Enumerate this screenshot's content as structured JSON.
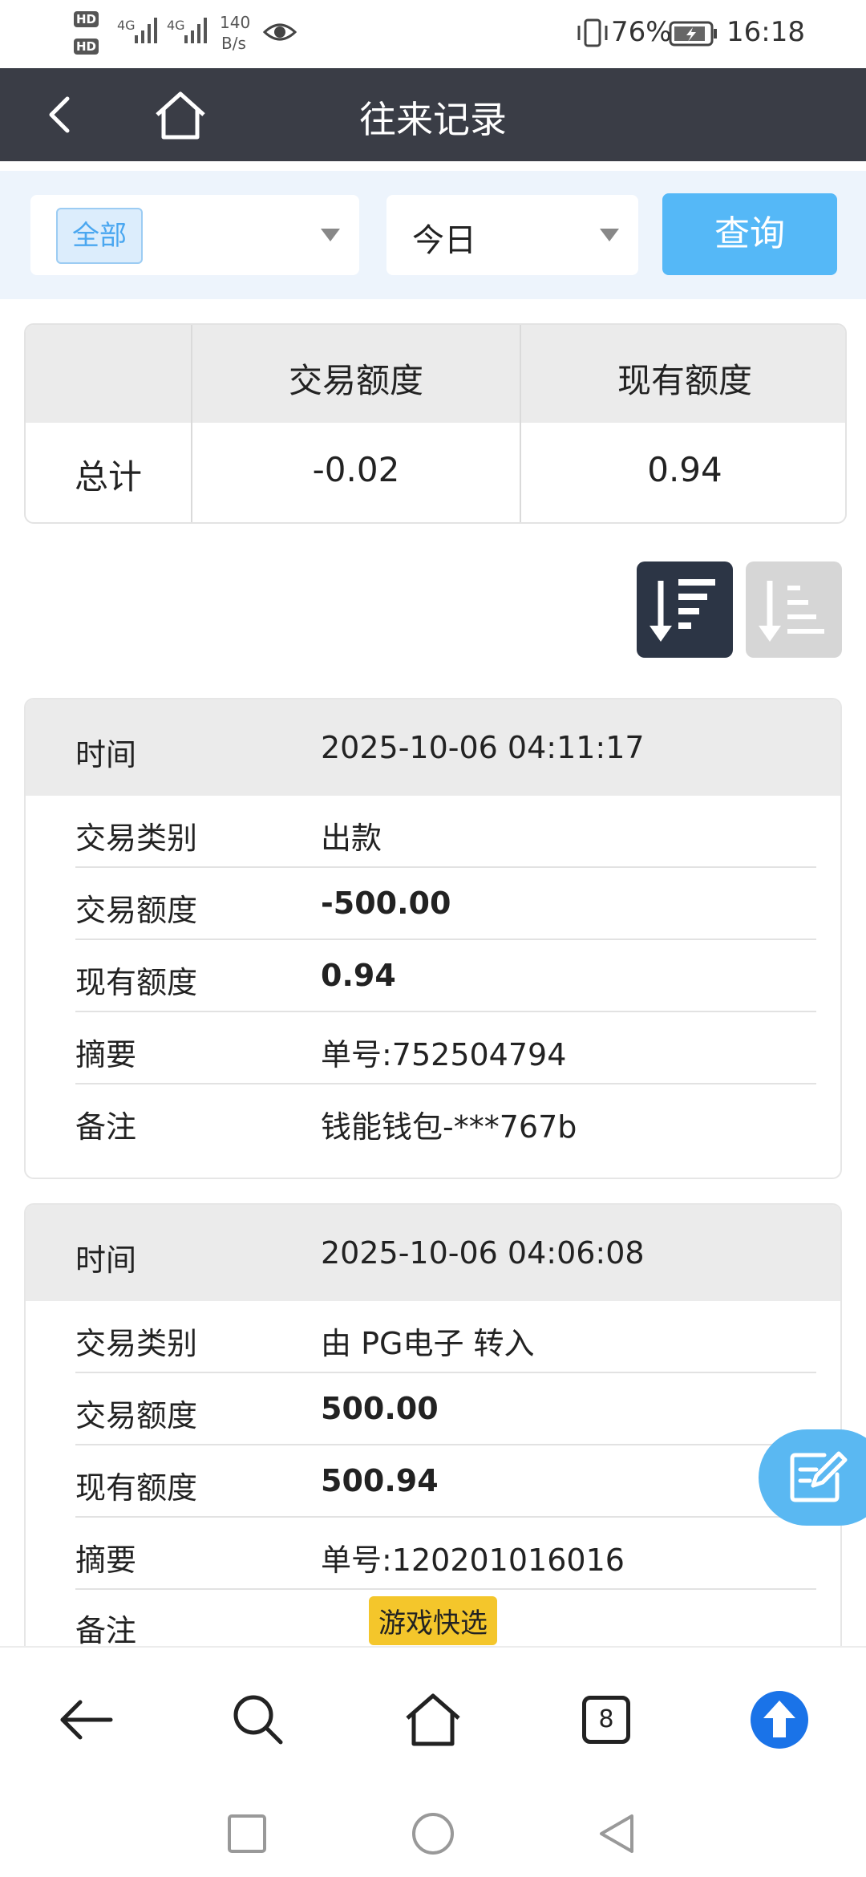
{
  "status_bar": {
    "hd1": "HD",
    "hd2": "HD",
    "net1": "4G",
    "net2": "4G",
    "speed_value": "140",
    "speed_unit": "B/s",
    "battery": "76%",
    "time": "16:18"
  },
  "header": {
    "title": "往来记录"
  },
  "filter": {
    "type_select": "全部",
    "date_select": "今日",
    "query_button": "查询"
  },
  "summary": {
    "col1": "交易额度",
    "col2": "现有额度",
    "row_label": "总计",
    "trade_total": "-0.02",
    "balance": "0.94"
  },
  "records": [
    {
      "time_label": "时间",
      "time": "2025-10-06 04:11:17",
      "type_label": "交易类别",
      "type": "出款",
      "amount_label": "交易额度",
      "amount": "-500.00",
      "balance_label": "现有额度",
      "balance": "0.94",
      "summary_label": "摘要",
      "summary": "单号:752504794",
      "note_label": "备注",
      "note": "钱能钱包-***767b"
    },
    {
      "time_label": "时间",
      "time": "2025-10-06 04:06:08",
      "type_label": "交易类别",
      "type": "由 PG电子 转入",
      "amount_label": "交易额度",
      "amount": "500.00",
      "balance_label": "现有额度",
      "balance": "500.94",
      "summary_label": "摘要",
      "summary": "单号:120201016016",
      "note_label": "备注",
      "note": "游戏快选"
    }
  ],
  "bottom_nav": {
    "tabs_count": "8"
  },
  "colors": {
    "header_bg": "#3a3d46",
    "accent": "#55b8f7",
    "tag_yellow": "#f4c62b",
    "upload_blue": "#1a73e8"
  }
}
